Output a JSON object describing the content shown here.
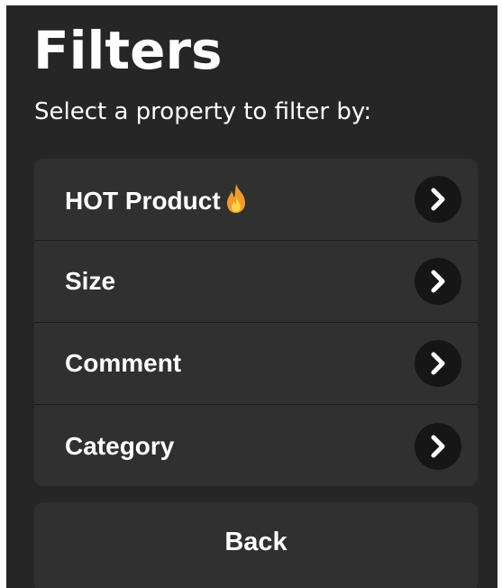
{
  "header": {
    "title": "Filters",
    "subtitle": "Select a property to filter by:"
  },
  "filters": [
    {
      "label": "HOT Product",
      "icon": "fire-emoji-icon",
      "icon_glyph": "🔥"
    },
    {
      "label": "Size"
    },
    {
      "label": "Comment"
    },
    {
      "label": "Category"
    }
  ],
  "actions": {
    "back_label": "Back"
  },
  "colors": {
    "background": "#262626",
    "card": "#303030",
    "chevron_circle": "#161616",
    "text": "#ffffff",
    "flame": "#f29b2b"
  }
}
